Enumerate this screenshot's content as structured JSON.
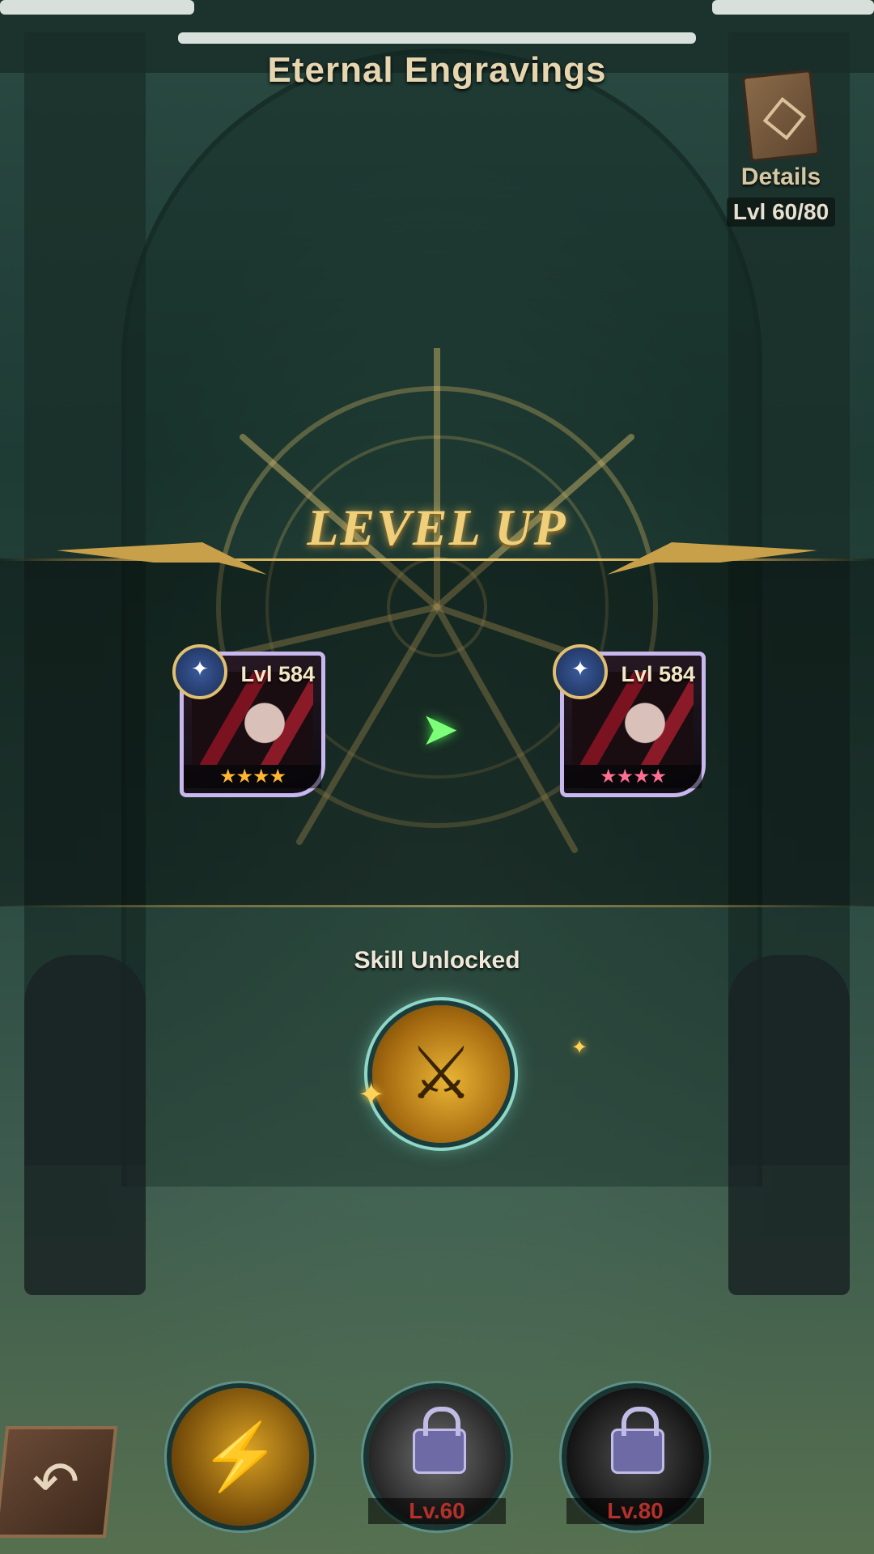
{
  "header": {
    "title": "Eternal Engravings",
    "details_label": "Details",
    "level_progress": "Lvl 60/80"
  },
  "banner": {
    "text": "LEVEL UP"
  },
  "hero_before": {
    "level": "Lvl 584",
    "stars": "★★★★",
    "star_color": "#ffb733"
  },
  "hero_after": {
    "level": "Lvl 584",
    "stars": "★★★★",
    "star_color": "#ff6f8f"
  },
  "skill_unlocked": {
    "label": "Skill Unlocked",
    "icon": "golden-skill-icon"
  },
  "bottom_skills": [
    {
      "icon": "golden-skill-icon",
      "locked": false,
      "level": ""
    },
    {
      "icon": "locked-skill-icon",
      "locked": true,
      "level": "Lv.60"
    },
    {
      "icon": "locked-skill-icon",
      "locked": true,
      "level": "Lv.80"
    }
  ],
  "colors": {
    "gold": "#f0cf7a",
    "accent_green": "#7dff7a",
    "lock_red": "#b5302a"
  }
}
